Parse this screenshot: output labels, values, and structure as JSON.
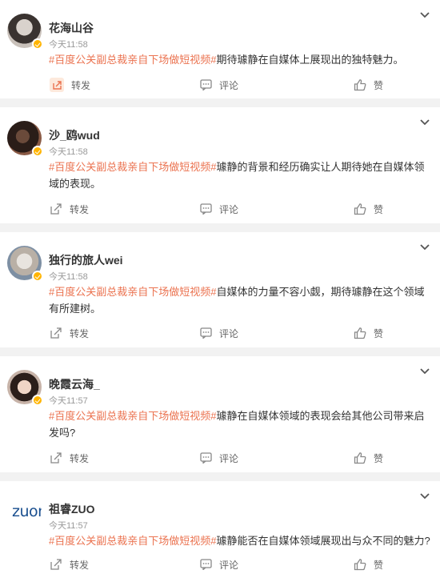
{
  "posts": [
    {
      "name": "花海山谷",
      "time": "今天11:58",
      "tag": "#百度公关副总裁亲自下场做短视频#",
      "text": "期待璩静在自媒体上展现出的独特魅力。",
      "repost": "转发",
      "comment": "评论",
      "like": "赞",
      "avatar": "photo-avatar"
    },
    {
      "name": "沙_鸥wud",
      "time": "今天11:58",
      "tag": "#百度公关副总裁亲自下场做短视频#",
      "text": "璩静的背景和经历确实让人期待她在自媒体领域的表现。",
      "repost": "转发",
      "comment": "评论",
      "like": "赞",
      "avatar": "photo-avatar"
    },
    {
      "name": "独行的旅人wei",
      "time": "今天11:58",
      "tag": "#百度公关副总裁亲自下场做短视频#",
      "text": "自媒体的力量不容小觑，期待璩静在这个领域有所建树。",
      "repost": "转发",
      "comment": "评论",
      "like": "赞",
      "avatar": "photo-avatar"
    },
    {
      "name": "晚霞云海_",
      "time": "今天11:57",
      "tag": "#百度公关副总裁亲自下场做短视频#",
      "text": "璩静在自媒体领域的表现会给其他公司带来启发吗?",
      "repost": "转发",
      "comment": "评论",
      "like": "赞",
      "avatar": "photo-avatar"
    },
    {
      "name": "祖睿ZUO",
      "time": "今天11:57",
      "tag": "#百度公关副总裁亲自下场做短视频#",
      "text": "璩静能否在自媒体领域展现出与众不同的魅力?",
      "repost": "转发",
      "comment": "评论",
      "like": "赞",
      "avatar": "logo-avatar",
      "logo_text": "zuora"
    }
  ],
  "colors": {
    "tag": "#eb7350",
    "badge": "#ffb400",
    "background": "#f2f2f2"
  },
  "icons": [
    "chevron-down-icon",
    "repost-icon",
    "comment-icon",
    "like-icon",
    "verified-badge-icon"
  ]
}
